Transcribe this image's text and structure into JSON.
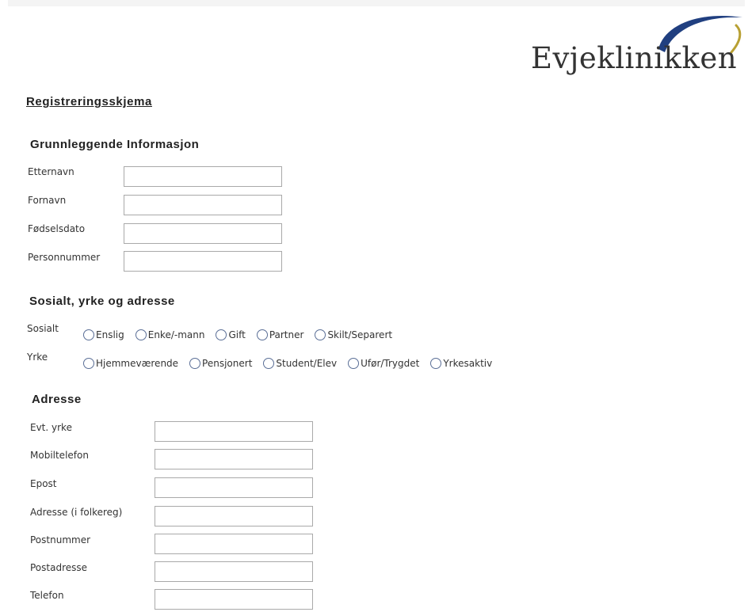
{
  "logo": {
    "text": "Evjeklinikken",
    "arc_color": "#203f80",
    "arc_accent_color": "#b8a033"
  },
  "form": {
    "title": "Registreringsskjema"
  },
  "basic_info": {
    "heading": "Grunnleggende Informasjon",
    "fields": [
      {
        "label": "Etternavn",
        "value": ""
      },
      {
        "label": "Fornavn",
        "value": ""
      },
      {
        "label": "Fødselsdato",
        "value": ""
      },
      {
        "label": "Personnummer",
        "value": ""
      }
    ]
  },
  "social": {
    "heading": "Sosialt, yrke og adresse",
    "sosialt": {
      "label": "Sosialt",
      "options": [
        "Enslig",
        "Enke/-mann",
        "Gift",
        "Partner",
        "Skilt/Separert"
      ]
    },
    "yrke": {
      "label": "Yrke",
      "options": [
        "Hjemmeværende",
        "Pensjonert",
        "Student/Elev",
        "Ufør/Trygdet",
        "Yrkesaktiv"
      ]
    }
  },
  "address": {
    "heading": "Adresse",
    "fields": [
      {
        "label": "Evt. yrke",
        "value": ""
      },
      {
        "label": "Mobiltelefon",
        "value": ""
      },
      {
        "label": "Epost",
        "value": ""
      },
      {
        "label": "Adresse (i folkereg)",
        "value": ""
      },
      {
        "label": "Postnummer",
        "value": ""
      },
      {
        "label": "Postadresse",
        "value": ""
      },
      {
        "label": "Telefon",
        "value": ""
      }
    ]
  }
}
